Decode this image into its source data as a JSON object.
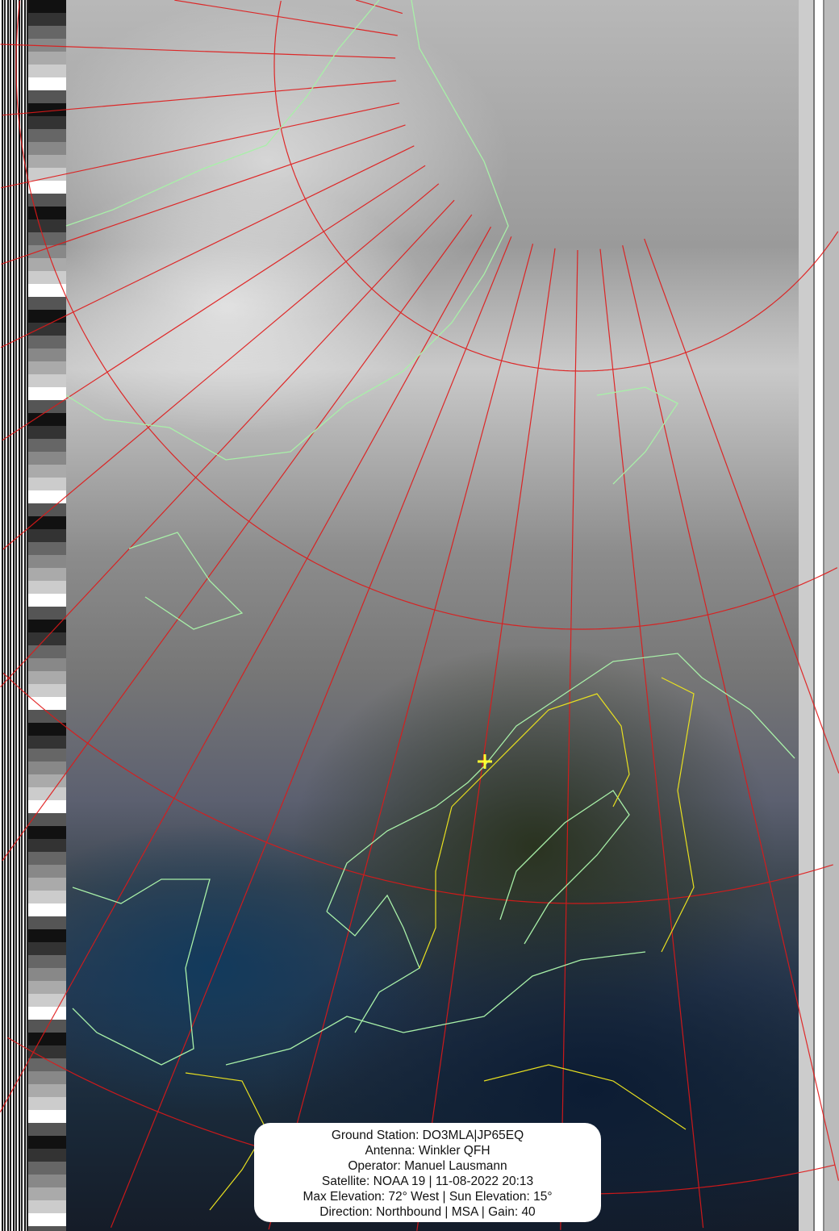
{
  "info_box": {
    "ground_station": "Ground Station: DO3MLA|JP65EQ",
    "antenna": "Antenna: Winkler QFH",
    "operator": "Operator: Manuel Lausmann",
    "satellite": "Satellite: NOAA 19 | 11-08-2022 20:13",
    "elevation": "Max Elevation: 72° West | Sun Elevation: 15°",
    "direction": "Direction: Northbound | MSA | Gain: 40"
  },
  "colors": {
    "graticule": "#e01818",
    "coastline": "#a8f0a8",
    "borders": "#e8e020",
    "station_marker": "#ffff30"
  }
}
